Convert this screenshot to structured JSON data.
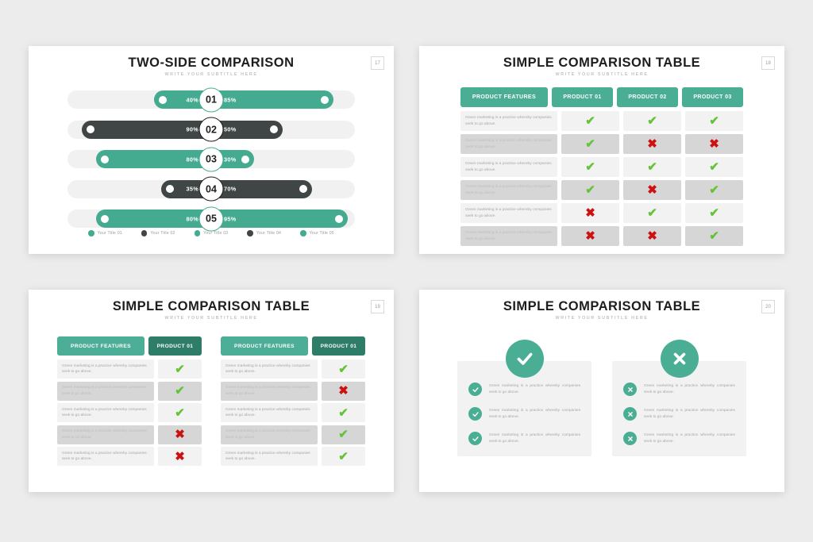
{
  "theme": {
    "background": "#ececec",
    "slide_bg": "#ffffff",
    "teal": "#45ab90",
    "teal_light": "#4dae98",
    "teal_dark": "#2e7d68",
    "charcoal": "#404545",
    "check_green": "#64c337",
    "cross_red": "#cc1111",
    "track_gray": "#f1f1f1",
    "row_light": "#f2f2f2",
    "row_dark": "#d6d6d6"
  },
  "slides": [
    {
      "id": "slide-17",
      "page_number": "17",
      "title": "TWO-SIDE COMPARISON",
      "subtitle": "WRITE YOUR SUBTITLE HERE",
      "bars": [
        {
          "number": "01",
          "left_pct": "40%",
          "right_pct": "85%",
          "color": "green",
          "left_value": 40,
          "right_value": 85
        },
        {
          "number": "02",
          "left_pct": "90%",
          "right_pct": "50%",
          "color": "dark",
          "left_value": 90,
          "right_value": 50
        },
        {
          "number": "03",
          "left_pct": "80%",
          "right_pct": "30%",
          "color": "green",
          "left_value": 80,
          "right_value": 30
        },
        {
          "number": "04",
          "left_pct": "35%",
          "right_pct": "70%",
          "color": "dark",
          "left_value": 35,
          "right_value": 70
        },
        {
          "number": "05",
          "left_pct": "80%",
          "right_pct": "95%",
          "color": "green",
          "left_value": 80,
          "right_value": 95
        }
      ],
      "legend": [
        {
          "label": "Your Title 01",
          "color": "#45ab90"
        },
        {
          "label": "Your Title 02",
          "color": "#404545"
        },
        {
          "label": "Your Title 03",
          "color": "#45ab90"
        },
        {
          "label": "Your Title 04",
          "color": "#404545"
        },
        {
          "label": "Your Title 05",
          "color": "#45ab90"
        }
      ]
    },
    {
      "id": "slide-18",
      "page_number": "18",
      "title": "SIMPLE COMPARISON TABLE",
      "subtitle": "WRITE YOUR SUBTITLE HERE",
      "table": {
        "headers": [
          "PRODUCT FEATURES",
          "PRODUCT 01",
          "PRODUCT 02",
          "PRODUCT 03"
        ],
        "feature_text": "Green marketing is a practice whereby companies seek to go above.",
        "rows": [
          {
            "shade": "light",
            "marks": [
              "check",
              "check",
              "check"
            ]
          },
          {
            "shade": "dark",
            "marks": [
              "check",
              "cross",
              "cross"
            ]
          },
          {
            "shade": "light",
            "marks": [
              "check",
              "check",
              "check"
            ]
          },
          {
            "shade": "dark",
            "marks": [
              "check",
              "cross",
              "check"
            ]
          },
          {
            "shade": "light",
            "marks": [
              "cross",
              "check",
              "check"
            ]
          },
          {
            "shade": "dark",
            "marks": [
              "cross",
              "cross",
              "check"
            ]
          }
        ]
      }
    },
    {
      "id": "slide-19",
      "page_number": "19",
      "title": "SIMPLE COMPARISON TABLE",
      "subtitle": "WRITE YOUR SUBTITLE HERE",
      "feature_text": "Green marketing is a practice whereby companies seek to go above.",
      "tables": [
        {
          "headers": [
            "PRODUCT FEATURES",
            "PRODUCT 01"
          ],
          "rows": [
            {
              "shade": "light",
              "mark": "check"
            },
            {
              "shade": "dark",
              "mark": "check"
            },
            {
              "shade": "light",
              "mark": "check"
            },
            {
              "shade": "dark",
              "mark": "cross"
            },
            {
              "shade": "light",
              "mark": "cross"
            }
          ]
        },
        {
          "headers": [
            "PRODUCT FEATURES",
            "PRODUCT 01"
          ],
          "rows": [
            {
              "shade": "light",
              "mark": "check"
            },
            {
              "shade": "dark",
              "mark": "cross"
            },
            {
              "shade": "light",
              "mark": "check"
            },
            {
              "shade": "dark",
              "mark": "check"
            },
            {
              "shade": "light",
              "mark": "check"
            }
          ]
        }
      ]
    },
    {
      "id": "slide-20",
      "page_number": "20",
      "title": "SIMPLE COMPARISON TABLE",
      "subtitle": "WRITE YOUR SUBTITLE HERE",
      "item_text": "Green marketing is a practice whereby companies seek to go above.",
      "panels": [
        {
          "badge": "check",
          "items": [
            "check",
            "check",
            "check"
          ]
        },
        {
          "badge": "cross",
          "items": [
            "cross",
            "cross",
            "cross"
          ]
        }
      ]
    }
  ]
}
